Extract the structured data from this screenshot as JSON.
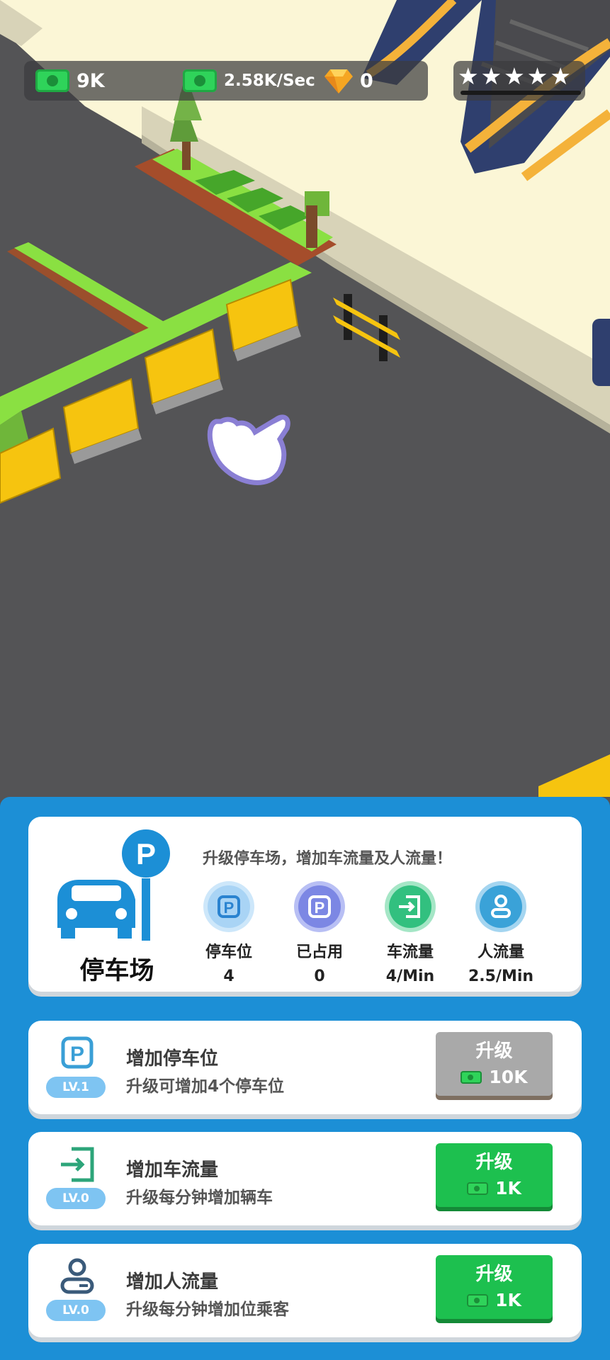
{
  "hud": {
    "cash": "9K",
    "income": "2.58K/Sec",
    "gems": "0",
    "stars": "★★★★★"
  },
  "parking": {
    "title": "停车场",
    "description": "升级停车场，增加车流量及人流量！",
    "stats": [
      {
        "label": "停车位",
        "value": "4",
        "icon": "parking-icon",
        "color": "#4fa7e8"
      },
      {
        "label": "已占用",
        "value": "0",
        "icon": "parking-occupied-icon",
        "color": "#6a78df"
      },
      {
        "label": "车流量",
        "value": "4/Min",
        "icon": "car-flow-icon",
        "color": "#2dbb7a"
      },
      {
        "label": "人流量",
        "value": "2.5/Min",
        "icon": "person-flow-icon",
        "color": "#3a9fd6"
      }
    ]
  },
  "upgrades": [
    {
      "title": "增加停车位",
      "subtitle": "升级可增加4个停车位",
      "level": "LV.1",
      "button_label": "升级",
      "cost": "10K",
      "state": "disabled"
    },
    {
      "title": "增加车流量",
      "subtitle": "升级每分钟增加辆车",
      "level": "LV.0",
      "button_label": "升级",
      "cost": "1K",
      "state": "enabled"
    },
    {
      "title": "增加人流量",
      "subtitle": "升级每分钟增加位乘客",
      "level": "LV.0",
      "button_label": "升级",
      "cost": "1K",
      "state": "enabled"
    }
  ],
  "colors": {
    "panel_bg": "#1c8fd6",
    "upgrade_green": "#1dc04f",
    "upgrade_gray": "#a9a9a9",
    "floor": "#545456"
  }
}
